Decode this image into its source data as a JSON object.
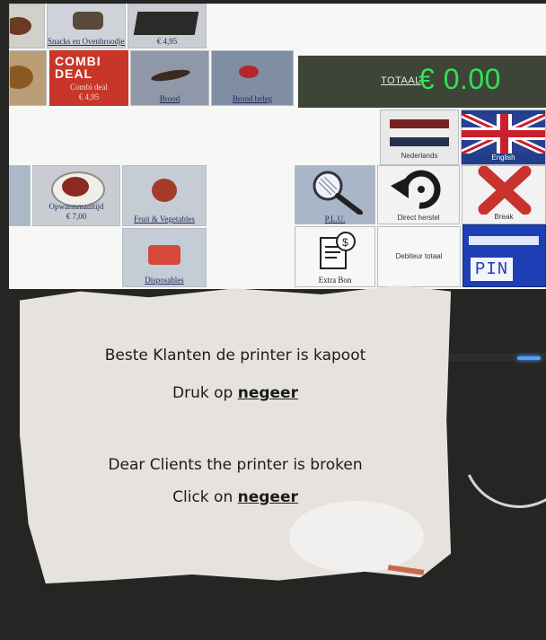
{
  "pos": {
    "totaal_label": "TOTAAL",
    "totaal_value": "€ 0.00",
    "tiles": {
      "snacks": "Snacks en Ovenbroodjes",
      "snacks_price": "€ 4,95",
      "combi_title_1": "COMBI",
      "combi_title_2": "DEAL",
      "combi_sub": "Combi deal",
      "combi_price": "€ 4,95",
      "brood": "Brood",
      "brood_beleg": "Brood beleg",
      "mealtime": "Opwarmmaaltijd",
      "mealtime_price": "€ 7,00",
      "fruit": "Fruit & Vegetables",
      "disposables": "Disposables",
      "nederlands": "Nederlands",
      "english": "English",
      "plu": "P.L.U.",
      "direct_herstel": "Direct herstel",
      "break": "Break",
      "extra_bon": "Extra Bon",
      "debiteur_totaal": "Debiteur totaal",
      "pin": "PIN"
    }
  },
  "note": {
    "line1": "Beste Klanten  de printer is kapoot",
    "line2_prefix": "Druk op ",
    "line2_emph": "negeer",
    "line3": "Dear Clients the printer is broken",
    "line4_prefix": "Click on ",
    "line4_emph": "negeer"
  },
  "colors": {
    "totaal_green": "#2ee35a",
    "combi_red": "#c8362a",
    "pin_blue": "#1d3fb6"
  }
}
